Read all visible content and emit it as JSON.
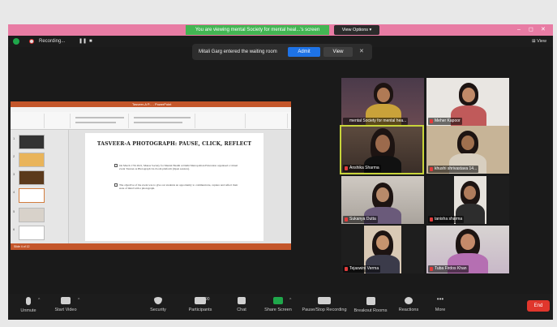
{
  "title_bar": {
    "share_banner": "You are viewing mental Society for mental heal...'s screen",
    "view_options": "View Options ▾",
    "window_controls": [
      "–",
      "◻",
      "✕"
    ]
  },
  "top_bar": {
    "recording_label": "Recording...",
    "pause_icon": "❚❚",
    "stop_icon": "■",
    "view_label": "⊞ View"
  },
  "waiting_room": {
    "message": "Mitali Garg entered the waiting room",
    "admit_label": "Admit",
    "view_label": "View",
    "close_label": "✕"
  },
  "shared_screen": {
    "window_title": "Tasveer-A P... - PowerPoint",
    "slide_title": "TASVEER-A PHOTOGRAPH: PAUSE, CLICK, REFLECT",
    "bullets": [
      "On March 17th 2021, Manas Society for Mental Health at Delhi Metropolitan Education organised a virtual event Tasveer-A Photograph via Zoom platform (Open session).",
      "The objective of the event was to give our students an opportunity to communicate, capture and reflect their state of mind with a photograph."
    ],
    "thumb_numbers": [
      "1",
      "2",
      "3",
      "4",
      "5",
      "6"
    ],
    "status_text": "Slide 4 of 12"
  },
  "participants": [
    {
      "name": "mental Society for mental hea...",
      "muted": false
    },
    {
      "name": "Meher Kapoor",
      "muted": true
    },
    {
      "name": "Anshika Sharma",
      "muted": true
    },
    {
      "name": "khushi shrivastava 14...",
      "muted": true
    },
    {
      "name": "Sukanya Dutta",
      "muted": true
    },
    {
      "name": "tanisha sharma",
      "muted": true
    },
    {
      "name": "Tejaswini Verma",
      "muted": true
    },
    {
      "name": "Tuba Firdos Khan",
      "muted": true
    }
  ],
  "toolbar": {
    "unmute": "Unmute",
    "start_video": "Start Video",
    "security": "Security",
    "participants": "Participants",
    "participants_count": "90",
    "chat": "Chat",
    "share_screen": "Share Screen",
    "pause_stop_recording": "Pause/Stop Recording",
    "breakout_rooms": "Breakout Rooms",
    "reactions": "Reactions",
    "more": "More",
    "end": "End"
  },
  "colors": {
    "title_bar": "#e87ca4",
    "share_banner": "#43b653",
    "admit": "#1e73e6",
    "active_speaker_border": "#c8d43a",
    "end_button": "#e0362c"
  }
}
